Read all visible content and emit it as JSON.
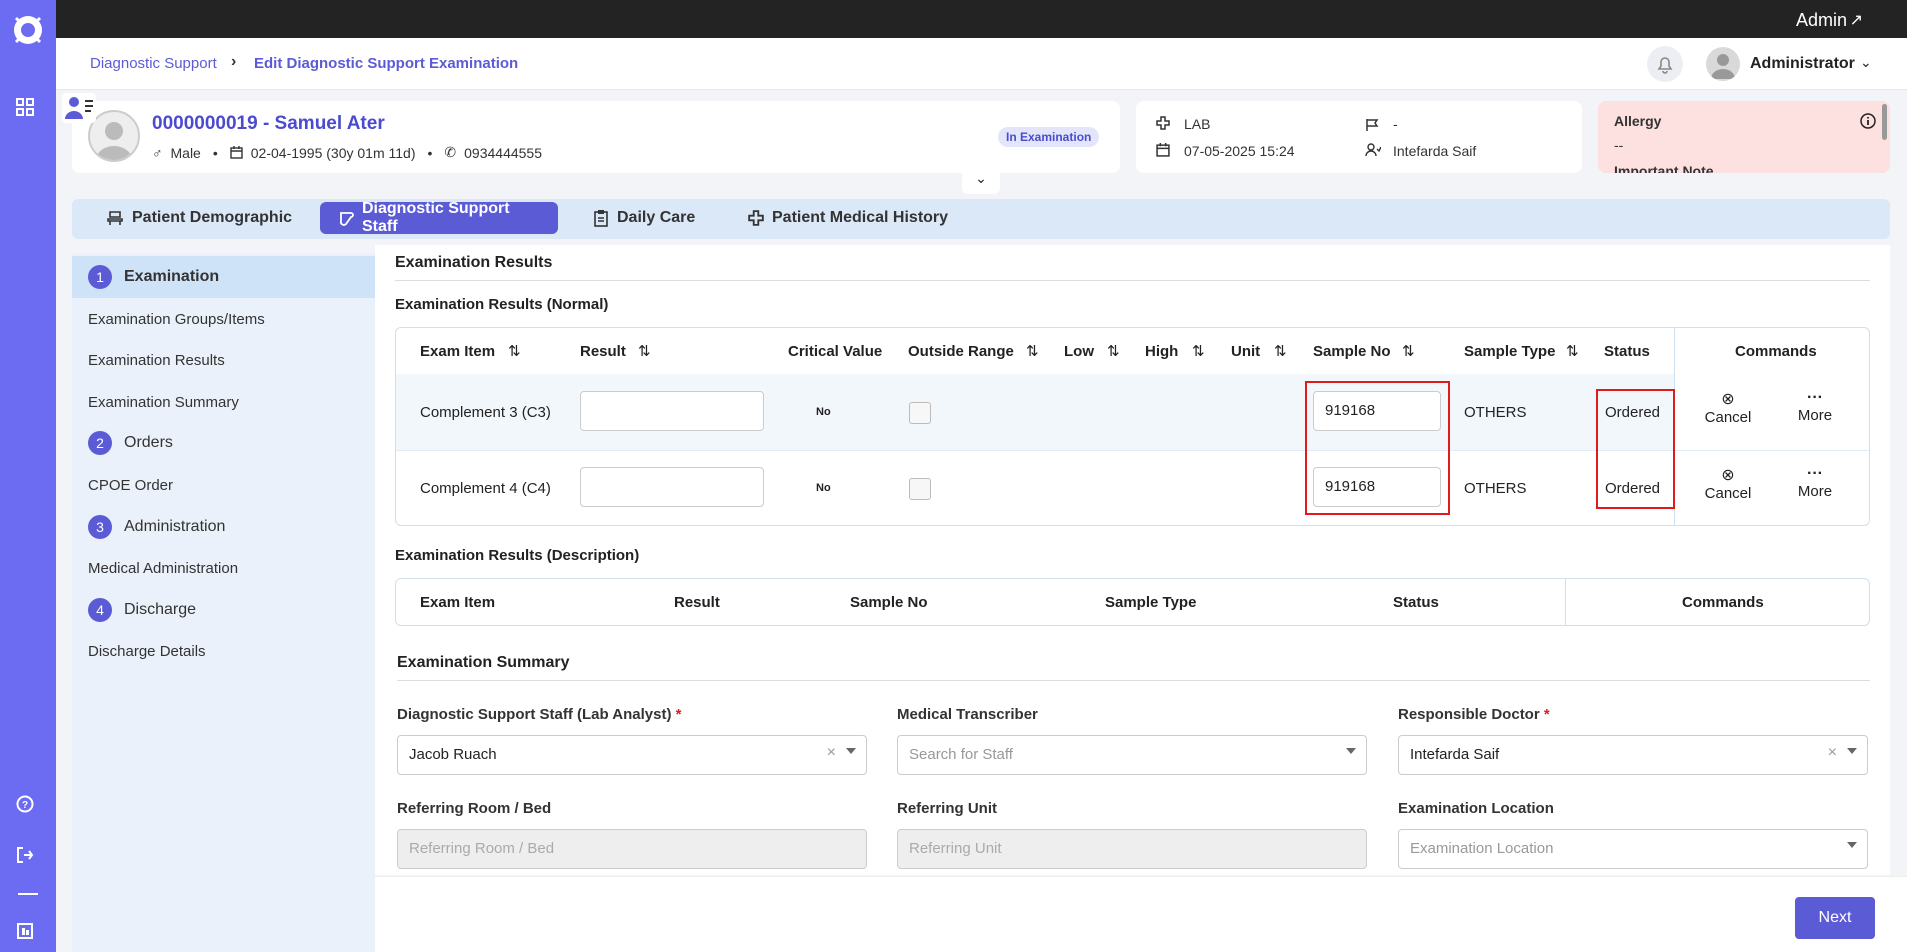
{
  "topbar": {
    "user": "Admin"
  },
  "header": {
    "breadcrumb": [
      "Diagnostic Support",
      "Edit Diagnostic Support Examination"
    ],
    "username": "Administrator"
  },
  "patient": {
    "name": "0000000019 - Samuel Ater",
    "sex": "Male",
    "dob": "02-04-1995 (30y 01m 11d)",
    "phone": "0934444555",
    "status": "In Examination"
  },
  "visit": {
    "type": "LAB",
    "datetime": "07-05-2025 15:24",
    "flag": "-",
    "doctor": "Intefarda Saif"
  },
  "allergy": {
    "title": "Allergy",
    "value": "--",
    "note_partial": "Important Note"
  },
  "tabs": [
    {
      "label": "Patient Demographic",
      "icon": "chair-icon"
    },
    {
      "label": "Diagnostic Support Staff",
      "icon": "bandage-icon"
    },
    {
      "label": "Daily Care",
      "icon": "clipboard-icon"
    },
    {
      "label": "Patient Medical History",
      "icon": "medical-cross-icon"
    }
  ],
  "steps": {
    "s1": {
      "num": "1",
      "label": "Examination"
    },
    "s1a": "Examination Groups/Items",
    "s1b": "Examination Results",
    "s1c": "Examination Summary",
    "s2": {
      "num": "2",
      "label": "Orders"
    },
    "s2a": "CPOE Order",
    "s3": {
      "num": "3",
      "label": "Administration"
    },
    "s3a": "Medical Administration",
    "s4": {
      "num": "4",
      "label": "Discharge"
    },
    "s4a": "Discharge Details"
  },
  "results": {
    "title": "Examination Results",
    "normal_title": "Examination Results (Normal)",
    "columns": [
      "Exam Item",
      "Result",
      "Critical Value",
      "Outside Range",
      "Low",
      "High",
      "Unit",
      "Sample No",
      "Sample Type",
      "Status",
      "Commands"
    ],
    "rows": [
      {
        "item": "Complement 3 (C3)",
        "result": "",
        "critical": "No",
        "sample_no": "919168",
        "sample_type": "OTHERS",
        "status": "Ordered",
        "cancel": "Cancel",
        "more": "More"
      },
      {
        "item": "Complement 4 (C4)",
        "result": "",
        "critical": "No",
        "sample_no": "919168",
        "sample_type": "OTHERS",
        "status": "Ordered",
        "cancel": "Cancel",
        "more": "More"
      }
    ],
    "desc_title": "Examination Results (Description)",
    "desc_columns": [
      "Exam Item",
      "Result",
      "Sample No",
      "Sample Type",
      "Status",
      "Commands"
    ]
  },
  "summary": {
    "title": "Examination Summary",
    "staff_label": "Diagnostic Support Staff (Lab Analyst)",
    "staff_value": "Jacob Ruach",
    "transcriber_label": "Medical Transcriber",
    "transcriber_placeholder": "Search for Staff",
    "doctor_label": "Responsible Doctor",
    "doctor_value": "Intefarda Saif",
    "room_label": "Referring Room / Bed",
    "room_placeholder": "Referring Room / Bed",
    "unit_label": "Referring Unit",
    "unit_placeholder": "Referring Unit",
    "location_label": "Examination Location",
    "location_placeholder": "Examination Location",
    "required_mark": "*"
  },
  "footer": {
    "next": "Next"
  }
}
